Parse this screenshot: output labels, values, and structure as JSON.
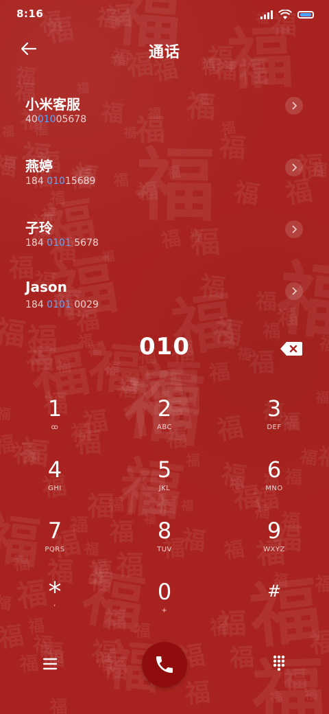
{
  "status_bar": {
    "time": "8:16"
  },
  "header": {
    "title": "通话"
  },
  "contacts": [
    {
      "name": "小米客服",
      "number_pre": "40",
      "number_match": "010",
      "number_post": "05678"
    },
    {
      "name": "燕婷",
      "number_pre": "184 ",
      "number_match": "010",
      "number_post": "15689"
    },
    {
      "name": "子玲",
      "number_pre": "184 ",
      "number_match": "0101",
      "number_post": " 5678"
    },
    {
      "name": "Jason",
      "number_pre": "184 ",
      "number_match": "0101",
      "number_post": " 0029"
    }
  ],
  "dial_input": {
    "value": "010"
  },
  "keypad": [
    {
      "digit": "1",
      "letters": "ꝏ"
    },
    {
      "digit": "2",
      "letters": "ABC"
    },
    {
      "digit": "3",
      "letters": "DEF"
    },
    {
      "digit": "4",
      "letters": "GHI"
    },
    {
      "digit": "5",
      "letters": "JKL"
    },
    {
      "digit": "6",
      "letters": "MNO"
    },
    {
      "digit": "7",
      "letters": "PQRS"
    },
    {
      "digit": "8",
      "letters": "TUV"
    },
    {
      "digit": "9",
      "letters": "WXYZ"
    },
    {
      "digit": "*",
      "letters": ","
    },
    {
      "digit": "0",
      "letters": "+"
    },
    {
      "digit": "#",
      "letters": ""
    }
  ],
  "colors": {
    "background": "#a8231f",
    "accent": "#5aa8ff",
    "call_button": "#8f0d0c"
  },
  "icons": {
    "back": "arrow-left-icon",
    "detail": "chevron-right-icon",
    "backspace": "backspace-icon",
    "menu": "menu-icon",
    "call": "phone-icon",
    "dialpad": "dialpad-icon"
  }
}
